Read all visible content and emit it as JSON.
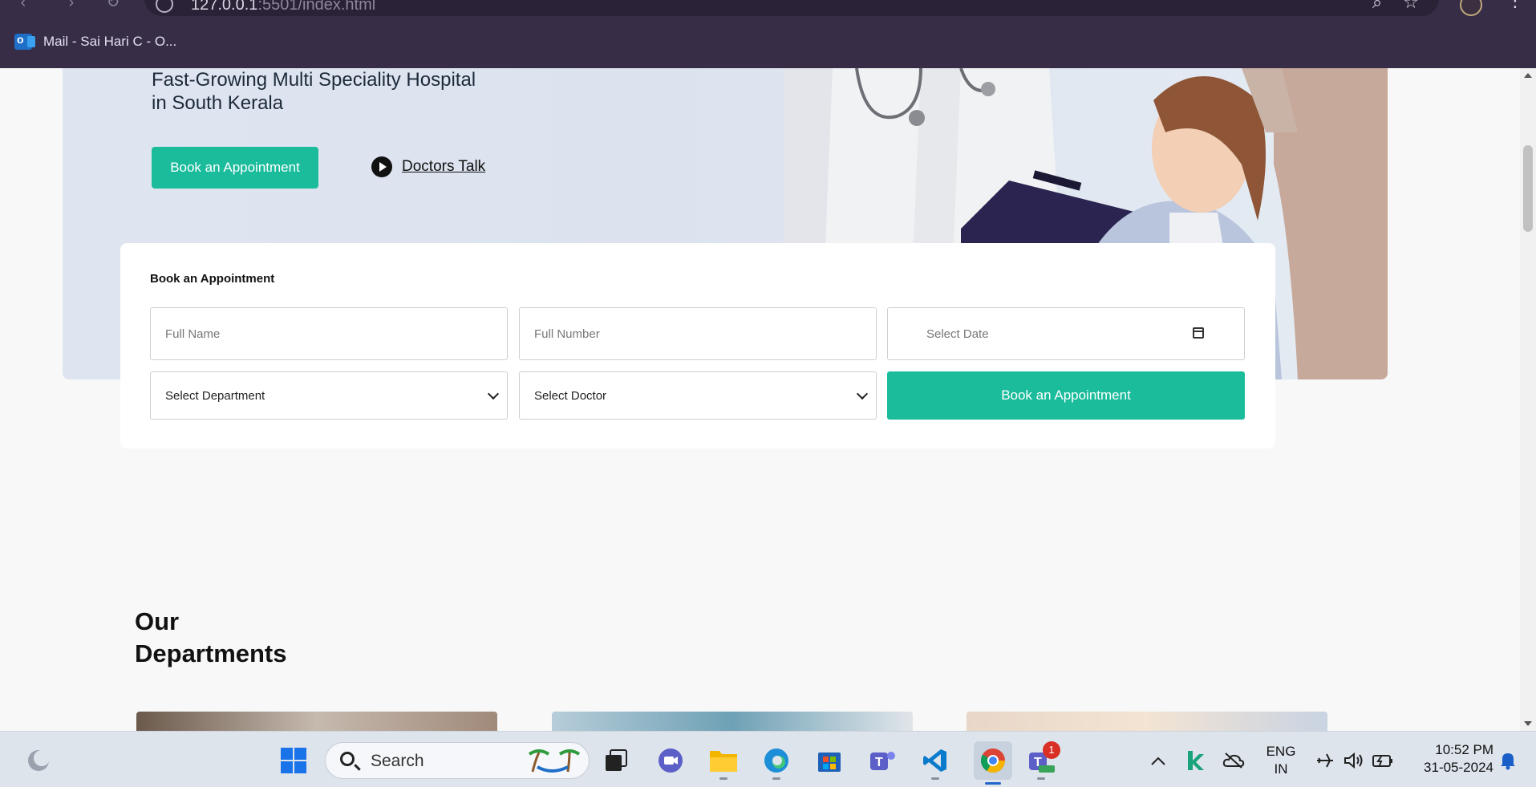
{
  "browser": {
    "url_main": "127.0.0.1",
    "url_rest": ":5501/index.html",
    "bookmark_label": "Mail - Sai Hari C - O..."
  },
  "hero": {
    "title_line1": "Fast-Growing Multi Speciality Hospital",
    "title_line2": "in South Kerala",
    "cta_label": "Book an Appointment",
    "video_link_label": "Doctors Talk"
  },
  "booking": {
    "title": "Book an Appointment",
    "name_placeholder": "Full Name",
    "number_placeholder": "Full Number",
    "date_placeholder": "Select Date",
    "department_selected": "Select Department",
    "doctor_selected": "Select Doctor",
    "submit_label": "Book an Appointment"
  },
  "departments": {
    "heading_line1": "Our",
    "heading_line2": "Departments"
  },
  "taskbar": {
    "search_label": "Search",
    "lang_line1": "ENG",
    "lang_line2": "IN",
    "time": "10:52 PM",
    "date": "31-05-2024",
    "teams_badge": "1"
  },
  "colors": {
    "accent": "#1abc9c",
    "chrome": "#372d47"
  }
}
